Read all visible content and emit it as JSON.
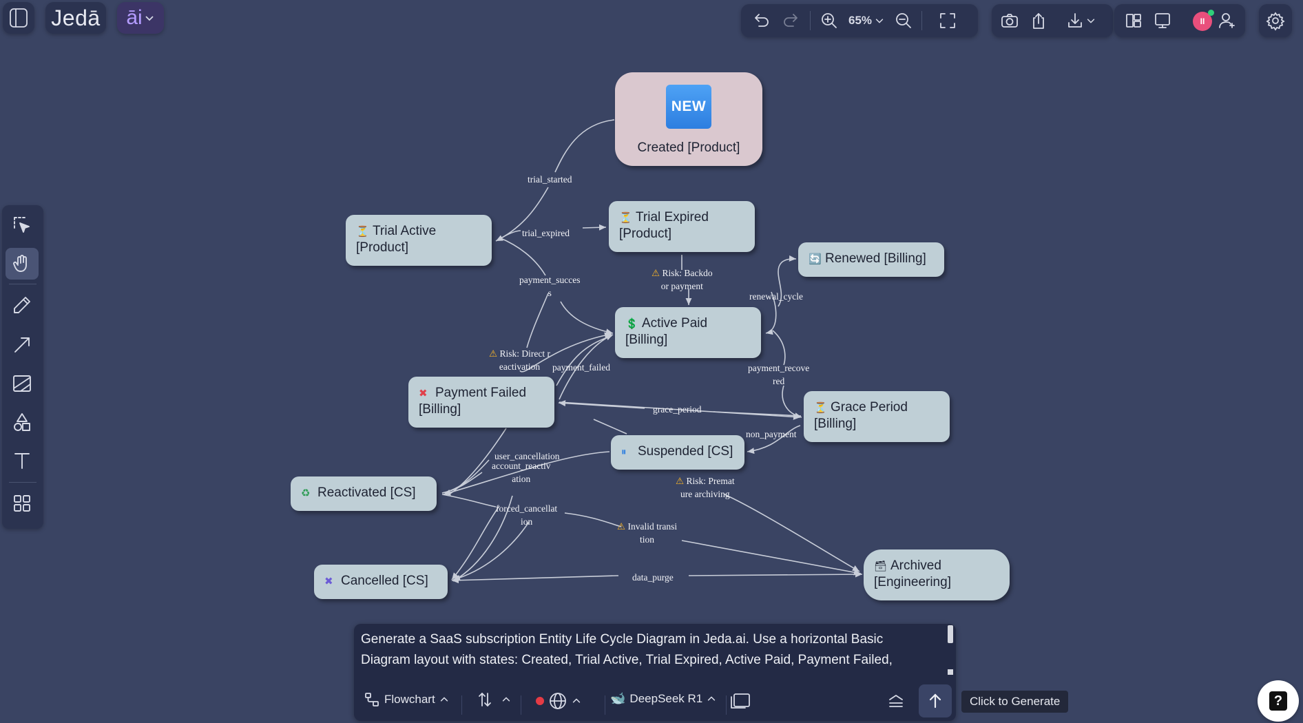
{
  "app": {
    "logo_text": "Jedā",
    "ai_label": "āi"
  },
  "toolbar": {
    "zoom_label": "65%"
  },
  "canvas": {
    "nodes": {
      "created": {
        "icon_text": "NEW",
        "label": "Created [Product]"
      },
      "trial_active": {
        "icon": "hourglass-icon",
        "line1": "Trial Active",
        "line2": "[Product]"
      },
      "trial_expired": {
        "icon": "hourglass-icon",
        "line1": "Trial Expired",
        "line2": "[Product]"
      },
      "renewed": {
        "icon": "refresh-icon",
        "line1": "Renewed [Billing]"
      },
      "active_paid": {
        "icon": "dollar-icon",
        "line1": "Active Paid",
        "line2": "[Billing]"
      },
      "payment_failed": {
        "icon": "cross-icon",
        "line1": "Payment Failed",
        "line2": "[Billing]"
      },
      "grace_period": {
        "icon": "hourglass-icon",
        "line1": "Grace Period",
        "line2": "[Billing]"
      },
      "suspended": {
        "icon": "pause-icon",
        "line1": "Suspended [CS]"
      },
      "reactivated": {
        "icon": "recycle-icon",
        "line1": "Reactivated [CS]"
      },
      "cancelled": {
        "icon": "x-icon",
        "line1": "Cancelled [CS]"
      },
      "archived": {
        "icon": "archive-icon",
        "line1": "Archived",
        "line2": "[Engineering]"
      }
    },
    "edge_labels": {
      "trial_started": "trial_started",
      "trial_expired": "trial_expired",
      "payment_success_1": "payment_succes",
      "payment_success_2": "s",
      "risk_backdoor_1": "Risk: Backdo",
      "risk_backdoor_2": "or payment",
      "renewal_cycle": "renewal_cycle",
      "risk_direct_1": "Risk: Direct r",
      "risk_direct_2": "eactivation",
      "payment_failed": "payment_failed",
      "payment_recovered_1": "payment_recove",
      "payment_recovered_2": "red",
      "grace_period": "grace_period",
      "non_payment": "non_payment",
      "user_cancellation": "user_cancellation",
      "account_reactivation_1": "account_reactiv",
      "account_reactivation_2": "ation",
      "risk_premature_1": "Risk: Premat",
      "risk_premature_2": "ure archiving",
      "forced_cancellation_1": "forced_cancellat",
      "forced_cancellation_2": "ion",
      "invalid_transition_1": "Invalid transi",
      "invalid_transition_2": "tion",
      "data_purge": "data_purge"
    }
  },
  "prompt": {
    "text": "Generate a SaaS subscription Entity Life Cycle Diagram in Jeda.ai. Use a horizontal Basic Diagram layout with states: Created, Trial Active, Trial Expired, Active Paid, Payment Failed,",
    "diagram_type": "Flowchart",
    "model": "DeepSeek R1",
    "generate_tooltip": "Click to Generate"
  },
  "colors": {
    "background": "#3a4463",
    "panel": "#2b3350",
    "node_fill": "#bfcfd6",
    "created_node_fill": "#dac8cf",
    "warning": "#f3b229"
  }
}
